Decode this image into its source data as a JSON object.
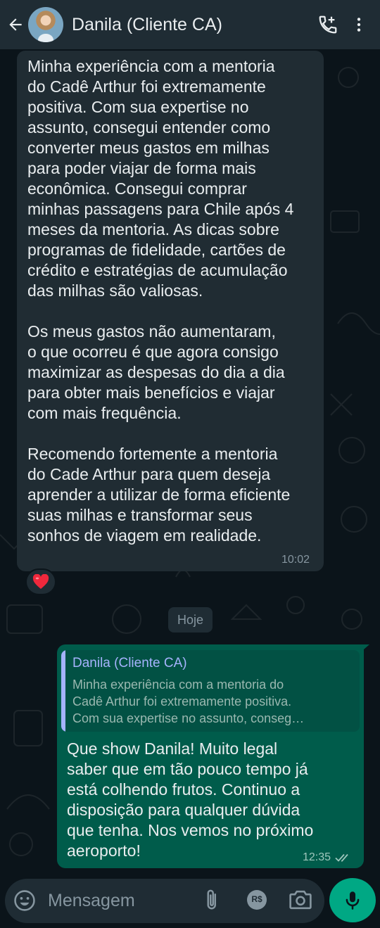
{
  "header": {
    "contact_name": "Danila (Cliente CA)"
  },
  "conversation": {
    "incoming": {
      "text": "Minha experiência com a mentoria\ndo Cadê Arthur foi extremamente\npositiva. Com sua expertise no\nassunto, consegui entender como\nconverter meus gastos em milhas\npara poder viajar de forma mais\neconômica. Consegui comprar\nminhas passagens para Chile após 4\nmeses da mentoria. As dicas sobre\nprogramas de fidelidade, cartões de\ncrédito e estratégias de acumulação\ndas milhas são valiosas.\n\nOs meus gastos não aumentaram,\no que ocorreu é que agora consigo\nmaximizar as despesas do dia a dia\npara obter mais benefícios e viajar\ncom mais frequência.\n\nRecomendo fortemente a mentoria\ndo Cade Arthur para quem deseja\naprender a utilizar de forma eficiente\nsuas milhas e transformar seus\nsonhos de viagem em realidade.",
      "time": "10:02",
      "reaction": "❤️"
    },
    "date_divider": "Hoje",
    "outgoing": {
      "quote_author": "Danila (Cliente CA)",
      "quote_lines": [
        "Minha experiência com a mentoria do",
        "Cadê Arthur foi extremamente positiva.",
        "Com sua expertise no assunto, conseg…"
      ],
      "text": "Que show Danila! Muito legal\nsaber que em tão pouco tempo já\nestá colhendo frutos. Continuo a\ndisposição para qualquer dúvida\nque tenha. Nos vemos no próximo\naeroporto!",
      "time": "12:35",
      "status": "read"
    }
  },
  "composer": {
    "placeholder": "Mensagem",
    "payment_label": "R$"
  },
  "colors": {
    "background": "#0b141a",
    "header": "#1f2c34",
    "incoming_bubble": "#202c33",
    "outgoing_bubble": "#005c4b",
    "accent": "#00a884",
    "quote_author": "#a5b3fd"
  },
  "icons": [
    "back-arrow-icon",
    "add-call-icon",
    "more-vert-icon",
    "emoji-icon",
    "attach-icon",
    "payment-icon",
    "camera-icon",
    "mic-icon",
    "double-check-icon"
  ]
}
